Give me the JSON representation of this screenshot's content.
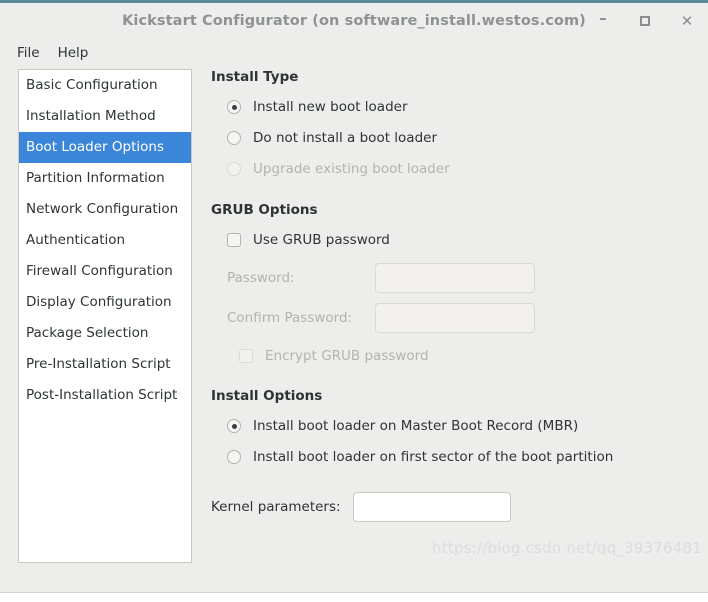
{
  "window": {
    "title": "Kickstart Configurator (on software_install.westos.com)",
    "controls": {
      "minimize": "–",
      "maximize": "",
      "close": "✕"
    }
  },
  "menubar": {
    "items": [
      {
        "label": "File"
      },
      {
        "label": "Help"
      }
    ]
  },
  "sidebar": {
    "items": [
      {
        "label": "Basic Configuration",
        "selected": false
      },
      {
        "label": "Installation Method",
        "selected": false
      },
      {
        "label": "Boot Loader Options",
        "selected": true
      },
      {
        "label": "Partition Information",
        "selected": false
      },
      {
        "label": "Network Configuration",
        "selected": false
      },
      {
        "label": "Authentication",
        "selected": false
      },
      {
        "label": "Firewall Configuration",
        "selected": false
      },
      {
        "label": "Display Configuration",
        "selected": false
      },
      {
        "label": "Package Selection",
        "selected": false
      },
      {
        "label": "Pre-Installation Script",
        "selected": false
      },
      {
        "label": "Post-Installation Script",
        "selected": false
      }
    ]
  },
  "install_type": {
    "title": "Install Type",
    "options": [
      {
        "label": "Install new boot loader",
        "checked": true,
        "disabled": false
      },
      {
        "label": "Do not install a boot loader",
        "checked": false,
        "disabled": false
      },
      {
        "label": "Upgrade existing boot loader",
        "checked": false,
        "disabled": true
      }
    ]
  },
  "grub_options": {
    "title": "GRUB Options",
    "use_grub_password": {
      "label": "Use GRUB password",
      "checked": false,
      "disabled": false
    },
    "password": {
      "label": "Password:",
      "value": "",
      "placeholder": "",
      "disabled": true
    },
    "confirm_password": {
      "label": "Confirm Password:",
      "value": "",
      "placeholder": "",
      "disabled": true
    },
    "encrypt": {
      "label": "Encrypt GRUB password",
      "checked": false,
      "disabled": true
    }
  },
  "install_options": {
    "title": "Install Options",
    "options": [
      {
        "label": "Install boot loader on Master Boot Record (MBR)",
        "checked": true,
        "disabled": false
      },
      {
        "label": "Install boot loader on first sector of the boot partition",
        "checked": false,
        "disabled": false
      }
    ],
    "kernel_parameters": {
      "label": "Kernel parameters:",
      "value": "",
      "placeholder": "",
      "disabled": false
    }
  },
  "watermark": {
    "text": "https://blog.csdn.net/qq_39376481"
  },
  "colors": {
    "accent": "#3b86d8",
    "window_bg": "#ededeb",
    "border": "#cdc7c2",
    "text": "#2e3436",
    "disabled_text": "#b5b2ae",
    "titlebar_text": "#8f9295",
    "top_border": "#5b8a99"
  }
}
